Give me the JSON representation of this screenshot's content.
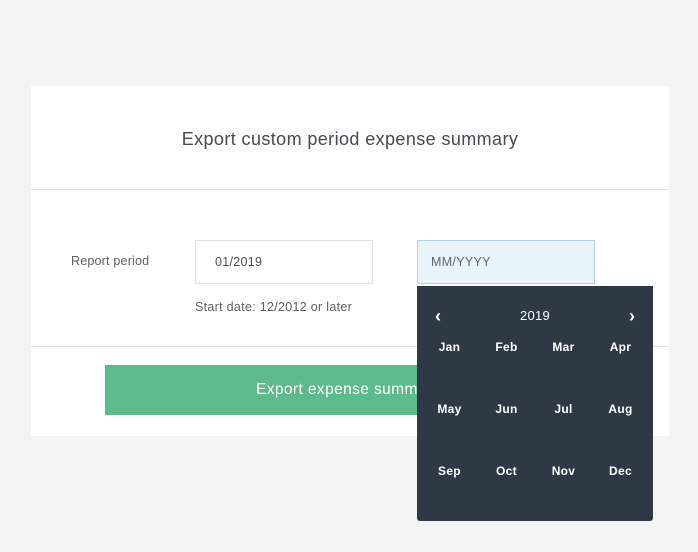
{
  "dialog": {
    "title": "Export custom period expense summary",
    "report_period_label": "Report period",
    "start_date_value": "01/2019",
    "end_date_placeholder": "MM/YYYY",
    "hint": "Start date: 12/2012 or later",
    "export_button_label": "Export expense summ"
  },
  "month_picker": {
    "year": "2019",
    "prev_icon": "‹",
    "next_icon": "›",
    "months": [
      "Jan",
      "Feb",
      "Mar",
      "Apr",
      "May",
      "Jun",
      "Jul",
      "Aug",
      "Sep",
      "Oct",
      "Nov",
      "Dec"
    ]
  },
  "colors": {
    "background": "#f2f3f2",
    "button": "#5dba8b",
    "picker": "#2f3946",
    "active_field": "#e9f3fa"
  }
}
